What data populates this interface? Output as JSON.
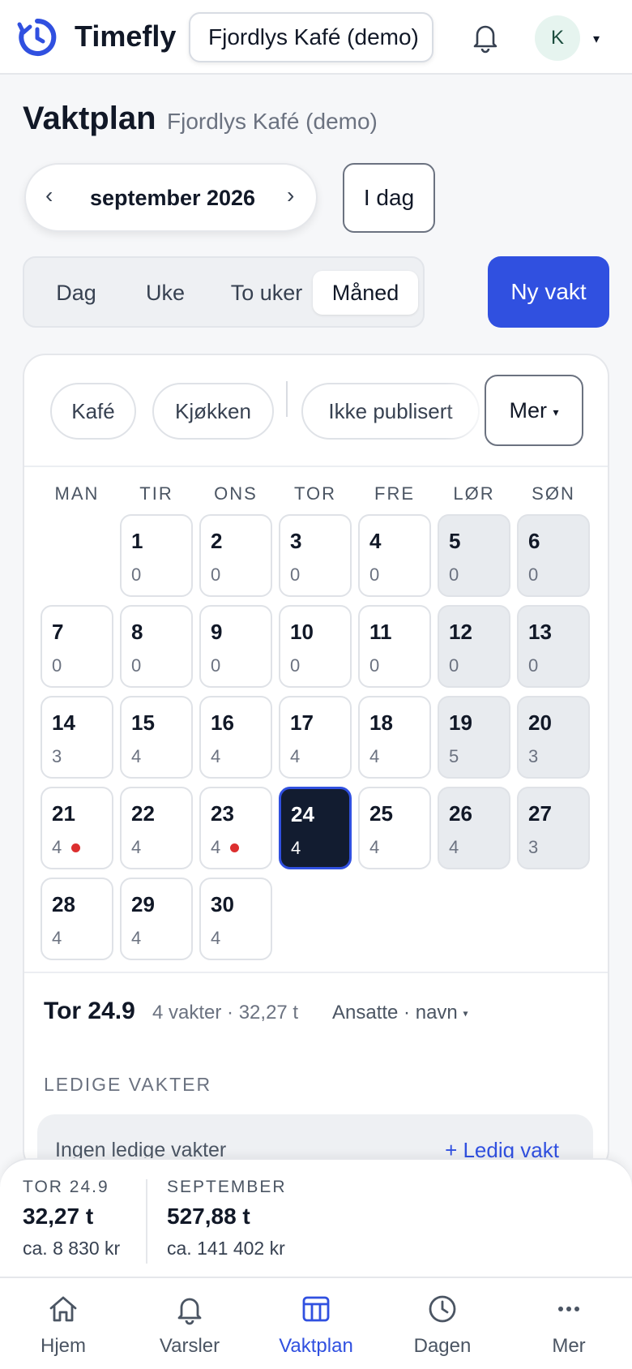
{
  "header": {
    "brand": "Timefly",
    "workspace": "Fjordlys Kafé (demo)",
    "avatar_initial": "K",
    "accent": "#3050E0"
  },
  "page": {
    "title": "Vaktplan",
    "subtitle": "Fjordlys Kafé (demo)"
  },
  "month_nav": {
    "prev": "‹",
    "label": "september 2026",
    "next": "›",
    "today": "I dag"
  },
  "views": [
    "Dag",
    "Uke",
    "To uker",
    "Måned"
  ],
  "active_view": "Måned",
  "new_shift": "Ny vakt",
  "filters": {
    "chips": [
      "Kafé",
      "Kjøkken",
      "Ikke publisert"
    ],
    "more": "Mer"
  },
  "weekdays": [
    "MAN",
    "TIR",
    "ONS",
    "TOR",
    "FRE",
    "LØR",
    "SØN"
  ],
  "calendar": {
    "days": [
      {
        "day": "1",
        "count": "0"
      },
      {
        "day": "2",
        "count": "0"
      },
      {
        "day": "3",
        "count": "0"
      },
      {
        "day": "4",
        "count": "0"
      },
      {
        "day": "5",
        "count": "0"
      },
      {
        "day": "6",
        "count": "0"
      },
      {
        "day": "7",
        "count": "0"
      },
      {
        "day": "8",
        "count": "0"
      },
      {
        "day": "9",
        "count": "0"
      },
      {
        "day": "10",
        "count": "0"
      },
      {
        "day": "11",
        "count": "0"
      },
      {
        "day": "12",
        "count": "0"
      },
      {
        "day": "13",
        "count": "0"
      },
      {
        "day": "14",
        "count": "3"
      },
      {
        "day": "15",
        "count": "4"
      },
      {
        "day": "16",
        "count": "4"
      },
      {
        "day": "17",
        "count": "4"
      },
      {
        "day": "18",
        "count": "4"
      },
      {
        "day": "19",
        "count": "5"
      },
      {
        "day": "20",
        "count": "3"
      },
      {
        "day": "21",
        "count": "4",
        "alert": true
      },
      {
        "day": "22",
        "count": "4"
      },
      {
        "day": "23",
        "count": "4",
        "alert": true
      },
      {
        "day": "24",
        "count": "4",
        "selected": true
      },
      {
        "day": "25",
        "count": "4"
      },
      {
        "day": "26",
        "count": "4"
      },
      {
        "day": "27",
        "count": "3"
      },
      {
        "day": "28",
        "count": "4"
      },
      {
        "day": "29",
        "count": "4"
      },
      {
        "day": "30",
        "count": "4"
      }
    ]
  },
  "day_summary": {
    "date": "Tor 24.9",
    "meta": "4 vakter · 32,27 t",
    "sort": "Ansatte · navn",
    "open_shifts_label": "LEDIGE VAKTER",
    "open_shifts_empty": "Ingen ledige vakter",
    "add_open_shift": "+ Ledig vakt"
  },
  "stats": {
    "day_label": "TOR 24.9",
    "day_hours": "32,27 t",
    "day_cost": "ca. 8 830 kr",
    "month_label": "SEPTEMBER",
    "month_hours": "527,88 t",
    "month_cost": "ca. 141 402 kr"
  },
  "bottom_nav": [
    {
      "label": "Hjem",
      "icon": "home-icon"
    },
    {
      "label": "Varsler",
      "icon": "bell-icon"
    },
    {
      "label": "Vaktplan",
      "icon": "table-icon",
      "active": true
    },
    {
      "label": "Dagen",
      "icon": "clock-icon"
    },
    {
      "label": "Mer",
      "icon": "more-dots-icon"
    }
  ]
}
